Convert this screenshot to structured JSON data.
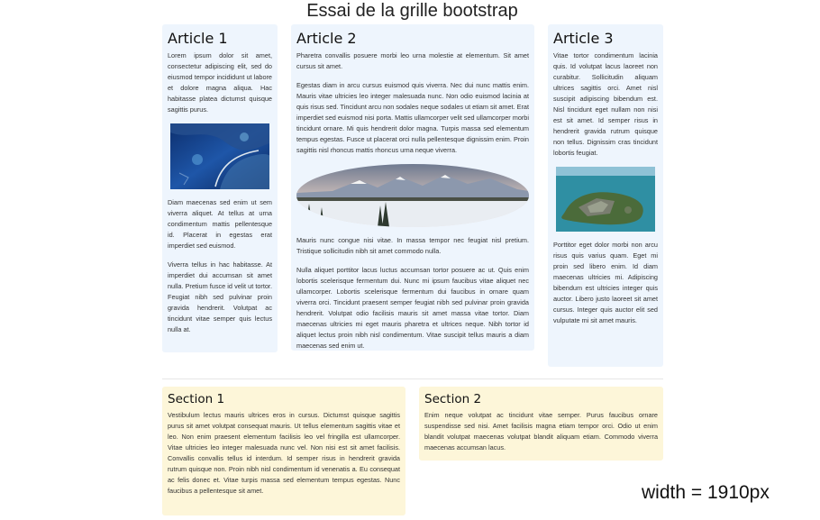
{
  "page": {
    "title": "Essai de la grille bootstrap",
    "width_note": "width = 1910px"
  },
  "articles": [
    {
      "title": "Article 1",
      "paragraphs": [
        "Lorem ipsum dolor sit amet, consectetur adipiscing elit, sed do eiusmod tempor incididunt ut labore et dolore magna aliqua. Hac habitasse platea dictumst quisque sagittis purus.",
        "Diam maecenas sed enim ut sem viverra aliquet. At tellus at urna condimentum mattis pellentesque id. Placerat in egestas erat imperdiet sed euismod.",
        "Viverra tellus in hac habitasse. At imperdiet dui accumsan sit amet nulla. Pretium fusce id velit ut tortor. Feugiat nibh sed pulvinar proin gravida hendrerit. Volutpat ac tincidunt vitae semper quis lectus nulla at."
      ]
    },
    {
      "title": "Article 2",
      "paragraphs": [
        "Pharetra convallis posuere morbi leo urna molestie at elementum. Sit amet cursus sit amet.",
        "Egestas diam in arcu cursus euismod quis viverra. Nec dui nunc mattis enim. Mauris vitae ultricies leo integer malesuada nunc. Non odio euismod lacinia at quis risus sed. Tincidunt arcu non sodales neque sodales ut etiam sit amet. Erat imperdiet sed euismod nisi porta. Mattis ullamcorper velit sed ullamcorper morbi tincidunt ornare. Mi quis hendrerit dolor magna. Turpis massa sed elementum tempus egestas. Fusce ut placerat orci nulla pellentesque dignissim enim. Proin sagittis nisl rhoncus mattis rhoncus urna neque viverra.",
        "Mauris nunc congue nisi vitae. In massa tempor nec feugiat nisl pretium. Tristique sollicitudin nibh sit amet commodo nulla.",
        "Nulla aliquet porttitor lacus luctus accumsan tortor posuere ac ut. Quis enim lobortis scelerisque fermentum dui. Nunc mi ipsum faucibus vitae aliquet nec ullamcorper. Lobortis scelerisque fermentum dui faucibus in ornare quam viverra orci. Tincidunt praesent semper feugiat nibh sed pulvinar proin gravida hendrerit. Volutpat odio facilisis mauris sit amet massa vitae tortor. Diam maecenas ultricies mi eget mauris pharetra et ultrices neque. Nibh tortor id aliquet lectus proin nibh nisl condimentum. Vitae suscipit tellus mauris a diam maecenas sed enim ut."
      ]
    },
    {
      "title": "Article 3",
      "paragraphs": [
        "Vitae tortor condimentum lacinia quis. Id volutpat lacus laoreet non curabitur. Sollicitudin aliquam ultrices sagittis orci. Amet nisl suscipit adipiscing bibendum est. Nisl tincidunt eget nullam non nisi est sit amet. Id semper risus in hendrerit gravida rutrum quisque non tellus. Dignissim cras tincidunt lobortis feugiat.",
        "Porttitor eget dolor morbi non arcu risus quis varius quam. Eget mi proin sed libero enim. Id diam maecenas ultricies mi. Adipiscing bibendum est ultricies integer quis auctor. Libero justo laoreet sit amet cursus. Integer quis auctor elit sed vulputate mi sit amet mauris."
      ]
    }
  ],
  "sections": [
    {
      "title": "Section 1",
      "text": "Vestibulum lectus mauris ultrices eros in cursus. Dictumst quisque sagittis purus sit amet volutpat consequat mauris. Ut tellus elementum sagittis vitae et leo. Non enim praesent elementum facilisis leo vel fringilla est ullamcorper. Vitae ultricies leo integer malesuada nunc vel. Non nisi est sit amet facilisis. Convallis convallis tellus id interdum. Id semper risus in hendrerit gravida rutrum quisque non. Proin nibh nisl condimentum id venenatis a. Eu consequat ac felis donec et. Vitae turpis massa sed elementum tempus egestas. Nunc faucibus a pellentesque sit amet."
    },
    {
      "title": "Section 2",
      "text": "Enim neque volutpat ac tincidunt vitae semper. Purus faucibus ornare suspendisse sed nisi. Amet facilisis magna etiam tempor orci. Odio ut enim blandit volutpat maecenas volutpat blandit aliquam etiam. Commodo viverra maecenas accumsan lacus."
    }
  ],
  "images": [
    {
      "name": "satellite-coast-image"
    },
    {
      "name": "snowy-mountain-landscape-image"
    },
    {
      "name": "island-fortress-aerial-image"
    }
  ]
}
